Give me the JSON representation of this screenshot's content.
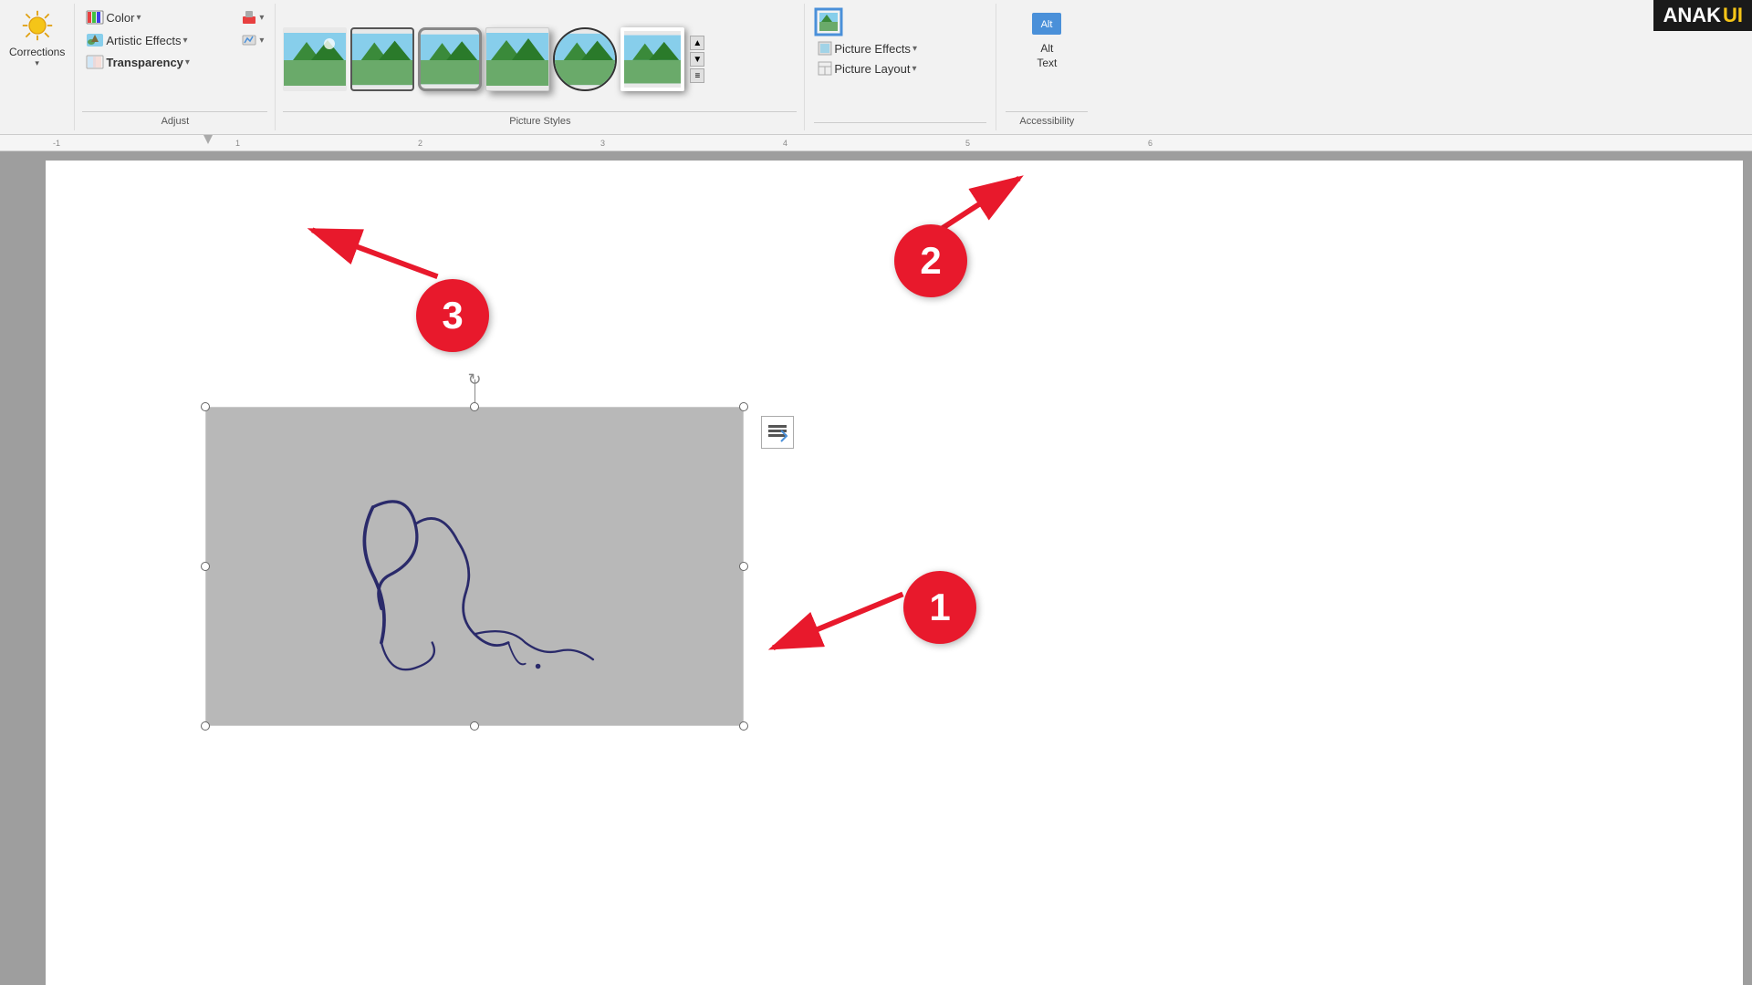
{
  "ribbon": {
    "adjust_group_label": "Adjust",
    "corrections_label": "Corrections",
    "color_label": "Color",
    "artistic_effects_label": "Artistic Effects",
    "transparency_label": "Transparency",
    "picture_styles_label": "Picture Styles",
    "picture_effects_label": "Picture Effects",
    "picture_layout_label": "Picture Layout",
    "accessibility_label": "Accessibility",
    "alt_text_label": "Alt\nText"
  },
  "annotations": {
    "circle1_label": "1",
    "circle2_label": "2",
    "circle3_label": "3"
  },
  "logo": {
    "anak": "ANAK",
    "ui": "UI"
  },
  "ruler": {
    "marks": [
      "-1",
      "1",
      "2",
      "3",
      "4",
      "5",
      "6"
    ]
  }
}
